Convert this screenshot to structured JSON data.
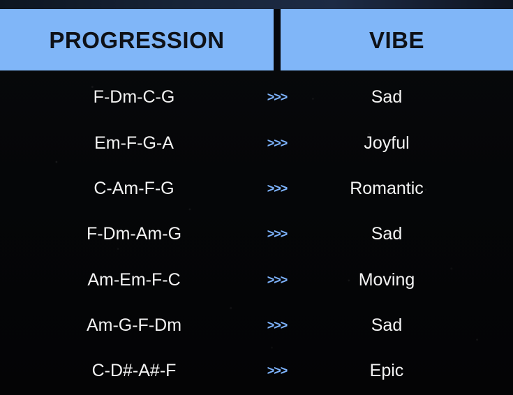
{
  "header": {
    "progression": "PROGRESSION",
    "vibe": "VIBE"
  },
  "rows": [
    {
      "progression": "F-Dm-C-G",
      "arrow": ">>>",
      "vibe": "Sad"
    },
    {
      "progression": "Em-F-G-A",
      "arrow": ">>>",
      "vibe": "Joyful"
    },
    {
      "progression": "C-Am-F-G",
      "arrow": ">>>",
      "vibe": "Romantic"
    },
    {
      "progression": "F-Dm-Am-G",
      "arrow": ">>>",
      "vibe": "Sad"
    },
    {
      "progression": "Am-Em-F-C",
      "arrow": ">>>",
      "vibe": "Moving"
    },
    {
      "progression": "Am-G-F-Dm",
      "arrow": ">>>",
      "vibe": "Sad"
    },
    {
      "progression": "C-D#-A#-F",
      "arrow": ">>>",
      "vibe": "Epic"
    }
  ],
  "colors": {
    "header_bg": "#80b6f8",
    "header_text": "#0e1117",
    "background": "#050608",
    "row_text": "#f3f3f3",
    "arrow": "#7eb4ff"
  }
}
